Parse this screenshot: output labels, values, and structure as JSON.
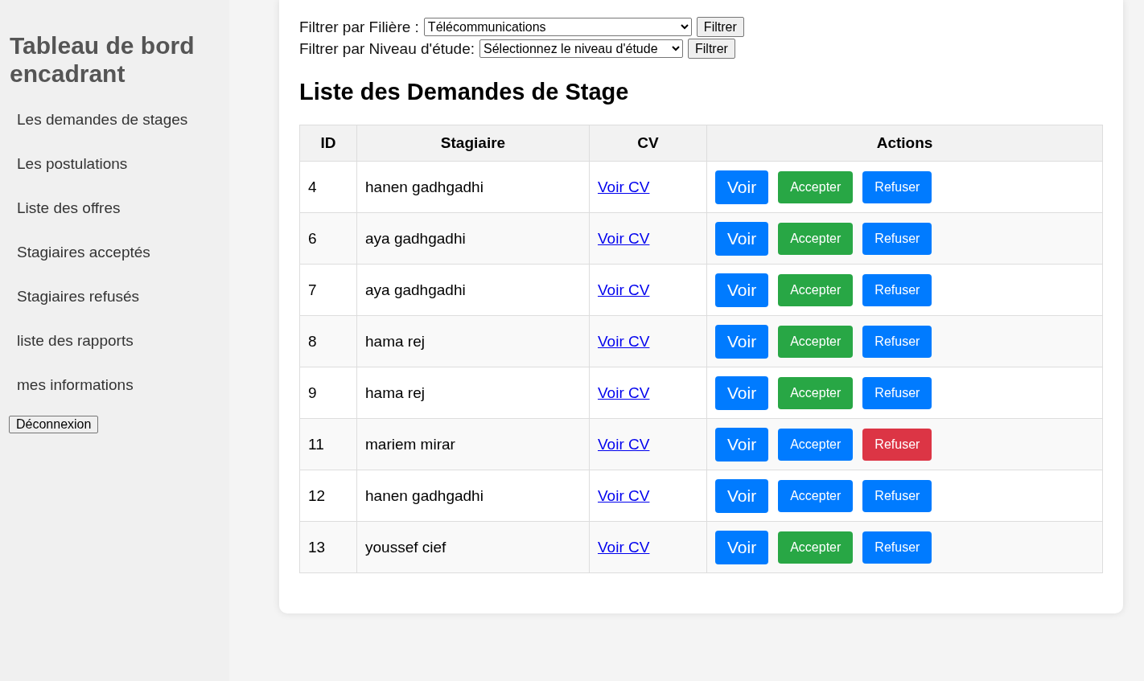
{
  "sidebar": {
    "title": "Tableau de bord encadrant",
    "items": [
      {
        "label": "Les demandes de stages"
      },
      {
        "label": "Les postulations"
      },
      {
        "label": "Liste des offres"
      },
      {
        "label": "Stagiaires acceptés"
      },
      {
        "label": "Stagiaires refusés"
      },
      {
        "label": "liste des rapports"
      },
      {
        "label": "mes informations"
      }
    ],
    "logout": "Déconnexion"
  },
  "filters": [
    {
      "label": "Filtrer par Filière :",
      "value": "Télécommunications",
      "button": "Filtrer"
    },
    {
      "label": "Filtrer par Niveau d'étude:",
      "value": "Sélectionnez le niveau d'étude",
      "button": "Filtrer"
    }
  ],
  "heading": "Liste des Demandes de Stage",
  "table": {
    "columns": [
      "ID",
      "Stagiaire",
      "CV",
      "Actions"
    ],
    "rows": [
      {
        "id": "4",
        "name": "hanen gadhgadhi",
        "cv": "Voir CV",
        "actions": [
          {
            "label": "Voir",
            "color": "#007bff"
          },
          {
            "label": "Accepter",
            "color": "#28a745"
          },
          {
            "label": "Refuser",
            "color": "#007bff"
          }
        ]
      },
      {
        "id": "6",
        "name": "aya gadhgadhi",
        "cv": "Voir CV",
        "actions": [
          {
            "label": "Voir",
            "color": "#007bff"
          },
          {
            "label": "Accepter",
            "color": "#28a745"
          },
          {
            "label": "Refuser",
            "color": "#007bff"
          }
        ]
      },
      {
        "id": "7",
        "name": "aya gadhgadhi",
        "cv": "Voir CV",
        "actions": [
          {
            "label": "Voir",
            "color": "#007bff"
          },
          {
            "label": "Accepter",
            "color": "#28a745"
          },
          {
            "label": "Refuser",
            "color": "#007bff"
          }
        ]
      },
      {
        "id": "8",
        "name": "hama rej",
        "cv": "Voir CV",
        "actions": [
          {
            "label": "Voir",
            "color": "#007bff"
          },
          {
            "label": "Accepter",
            "color": "#28a745"
          },
          {
            "label": "Refuser",
            "color": "#007bff"
          }
        ]
      },
      {
        "id": "9",
        "name": "hama rej",
        "cv": "Voir CV",
        "actions": [
          {
            "label": "Voir",
            "color": "#007bff"
          },
          {
            "label": "Accepter",
            "color": "#28a745"
          },
          {
            "label": "Refuser",
            "color": "#007bff"
          }
        ]
      },
      {
        "id": "11",
        "name": "mariem mirar",
        "cv": "Voir CV",
        "actions": [
          {
            "label": "Voir",
            "color": "#007bff"
          },
          {
            "label": "Accepter",
            "color": "#007bff"
          },
          {
            "label": "Refuser",
            "color": "#dc3545"
          }
        ]
      },
      {
        "id": "12",
        "name": "hanen gadhgadhi",
        "cv": "Voir CV",
        "actions": [
          {
            "label": "Voir",
            "color": "#007bff"
          },
          {
            "label": "Accepter",
            "color": "#007bff"
          },
          {
            "label": "Refuser",
            "color": "#007bff"
          }
        ]
      },
      {
        "id": "13",
        "name": "youssef cief",
        "cv": "Voir CV",
        "actions": [
          {
            "label": "Voir",
            "color": "#007bff"
          },
          {
            "label": "Accepter",
            "color": "#28a745"
          },
          {
            "label": "Refuser",
            "color": "#007bff"
          }
        ]
      }
    ]
  }
}
